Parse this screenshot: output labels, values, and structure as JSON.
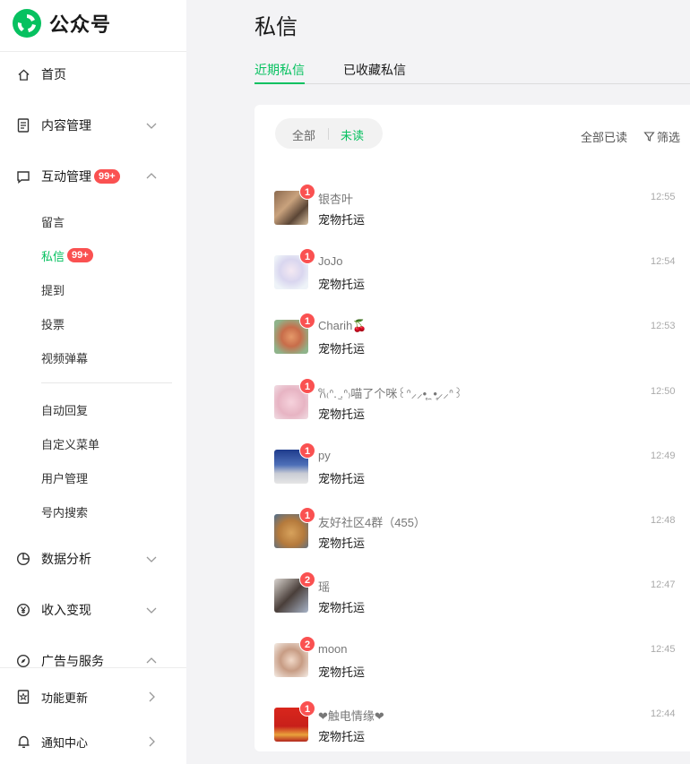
{
  "app": {
    "name": "公众号",
    "brand_color": "#07c160",
    "badge_color": "#fa5151"
  },
  "sidebar": {
    "home": {
      "label": "首页",
      "icon": "home-icon"
    },
    "content": {
      "label": "内容管理",
      "icon": "document-icon"
    },
    "interaction": {
      "label": "互动管理",
      "badge": "99+",
      "icon": "chat-icon"
    },
    "sub_items": {
      "comments": "留言",
      "messages": "私信",
      "messages_badge": "99+",
      "mentions": "提到",
      "votes": "投票",
      "danmaku": "视频弹幕",
      "auto_reply": "自动回复",
      "custom_menu": "自定义菜单",
      "users": "用户管理",
      "search": "号内搜索"
    },
    "analytics": {
      "label": "数据分析",
      "icon": "pie-chart-icon"
    },
    "monetize": {
      "label": "收入变现",
      "icon": "yen-icon"
    },
    "ads": {
      "label": "广告与服务",
      "icon": "compass-icon"
    },
    "updates": {
      "label": "功能更新",
      "icon": "update-icon"
    },
    "notifications": {
      "label": "通知中心",
      "icon": "bell-icon"
    }
  },
  "main": {
    "title": "私信",
    "tabs": [
      "近期私信",
      "已收藏私信"
    ],
    "filter_segment": {
      "all": "全部",
      "unread": "未读"
    },
    "mark_all_read": "全部已读",
    "filter_label": "筛选"
  },
  "messages": [
    {
      "name": "银杏叶",
      "preview": "宠物托运",
      "time": "12:55",
      "count": "1"
    },
    {
      "name": "JoJo",
      "preview": "宠物托运",
      "time": "12:54",
      "count": "1"
    },
    {
      "name": "Charih🍒",
      "preview": "宠物托运",
      "time": "12:53",
      "count": "1"
    },
    {
      "name": "𐙚₍ᐢ. ̫.ᐢ₎喵了个咪꒰ᐢ⸝⸝•̥ ̯ •̥⸝⸝ᐢ꒱",
      "preview": "宠物托运",
      "time": "12:50",
      "count": "1"
    },
    {
      "name": "py",
      "preview": "宠物托运",
      "time": "12:49",
      "count": "1"
    },
    {
      "name": "友好社区4群（455）",
      "preview": "宠物托运",
      "time": "12:48",
      "count": "1"
    },
    {
      "name": "瑶",
      "preview": "宠物托运",
      "time": "12:47",
      "count": "2"
    },
    {
      "name": "moon",
      "preview": "宠物托运",
      "time": "12:45",
      "count": "2"
    },
    {
      "name": "❤触电情缘❤",
      "preview": "宠物托运",
      "time": "12:44",
      "count": "1"
    }
  ]
}
